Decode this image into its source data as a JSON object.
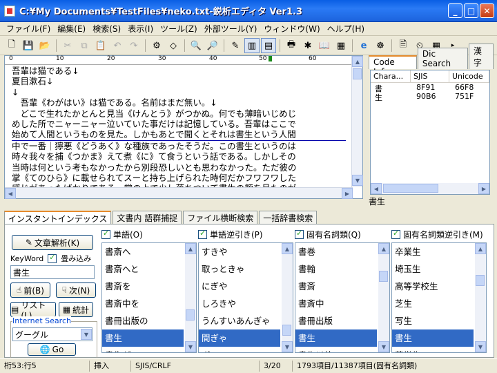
{
  "window": {
    "title": "C:¥My Documents¥TestFiles¥neko.txt-鋭析エディタ Ver1.3",
    "minimize": "_",
    "maximize": "□",
    "close": "✕"
  },
  "menu": [
    "ファイル(F)",
    "編集(E)",
    "検索(S)",
    "表示(I)",
    "ツール(Z)",
    "外部ツール(Y)",
    "ウィンドウ(W)",
    "ヘルプ(H)"
  ],
  "ruler": {
    "labels": [
      "0",
      "10",
      "20",
      "30",
      "40",
      "50",
      "60"
    ]
  },
  "editor_lines": [
    "吾輩は猫である↓",
    "夏目漱石↓",
    "↓",
    "　吾輩《わがはい》は猫である。名前はまだ無い。↓",
    "　どこで生れたかとんと見当《けんとう》がつかぬ。何でも薄暗いじめじ",
    "めした所でニャーニャー泣いていた事だけは記憶している。吾輩はここで",
    "始めて人間というものを見た。しかもあとで聞くとそれは書生という人間",
    "中で一番｜獰悪《どうあく》な種族であったそうだ。この書生というのは",
    "時々我々を捕《つかま》えて煮《に》て食うという話である。しかしその",
    "当時は何という考もなかったから別段恐しいとも思わなかった。ただ彼の",
    "掌《てのひら》に載せられてスーと持ち上げられた時何だかフワフワした",
    "感じがあったばかりである。掌の上で少し落ちついて書生の顔を見たのが"
  ],
  "right_tabs": [
    "Code Info.",
    "Dic Search",
    "漢字"
  ],
  "code_info": {
    "headers": [
      "Chara...",
      "SJIS",
      "Unicode"
    ],
    "rows": [
      [
        "書",
        "8F91",
        "66F8"
      ],
      [
        "生",
        "90B6",
        "751F"
      ]
    ]
  },
  "selected_text": "書生",
  "bottom_tabs": [
    "インスタントインデックス",
    "文書内 語群捕捉",
    "ファイル横断検索",
    "一括辞書検索"
  ],
  "controls": {
    "analyze": "文章解析(K)",
    "keyword_label": "KeyWord",
    "fold_label": "畳み込み",
    "keyword_value": "書生",
    "prev": "前(B)",
    "next": "次(N)",
    "list": "リスト(L)",
    "stats": "統計",
    "internet_label": "Internet Search",
    "engine": "グーグル",
    "go": "Go"
  },
  "columns": [
    {
      "title": "単語(O)",
      "items": [
        "書斎へ",
        "書斎へと",
        "書斎を",
        "書斎中を",
        "書冊出版の",
        "書生",
        "書生が"
      ],
      "selected": 5
    },
    {
      "title": "単語逆引き(P)",
      "items": [
        "すきや",
        "取っときゃ",
        "にぎや",
        "しろきや",
        "うんすいあんぎゃ",
        "間ぎゃ",
        "ぎゃ"
      ],
      "selected": 5
    },
    {
      "title": "固有名詞類(Q)",
      "items": [
        "書巻",
        "書翰",
        "書斎",
        "書斎中",
        "書冊出版",
        "書生",
        "書生以外"
      ],
      "selected": 5
    },
    {
      "title": "固有名詞類逆引き(M)",
      "items": [
        "卒業生",
        "埼玉生",
        "高等学校生",
        "芝生",
        "写生",
        "書生",
        "苦学生"
      ],
      "selected": 5
    }
  ],
  "status": [
    "桁53:行5",
    "挿入",
    "SJIS/CRLF",
    "3/20",
    "1793項目/11387項目(固有名詞類)"
  ]
}
